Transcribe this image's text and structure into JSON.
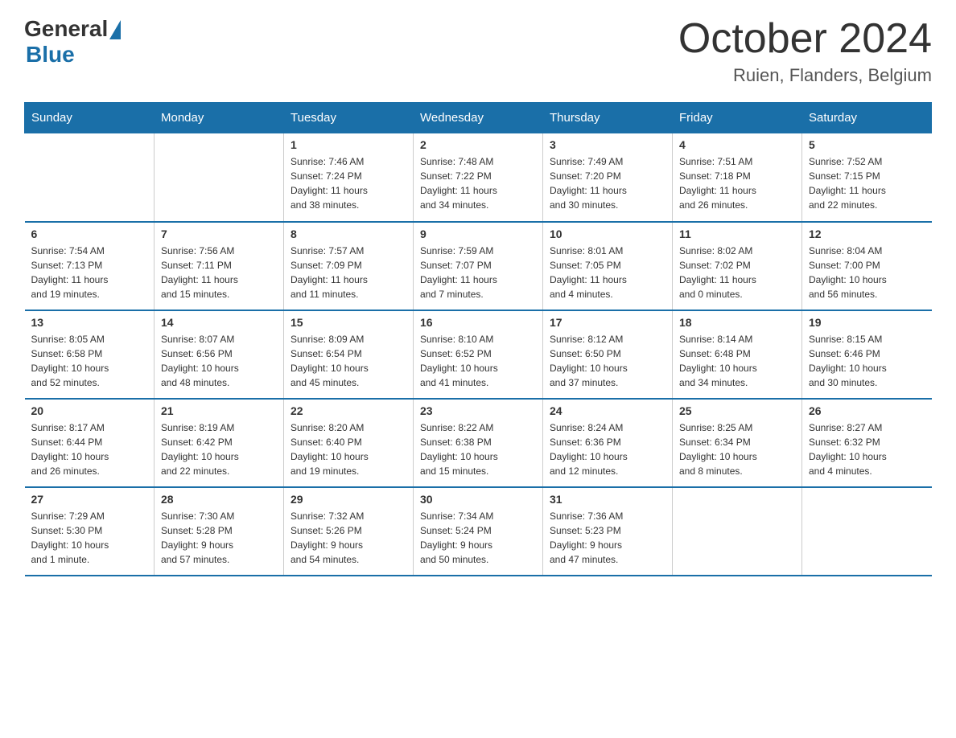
{
  "header": {
    "logo_general": "General",
    "logo_blue": "Blue",
    "month_title": "October 2024",
    "location": "Ruien, Flanders, Belgium"
  },
  "days_header": [
    "Sunday",
    "Monday",
    "Tuesday",
    "Wednesday",
    "Thursday",
    "Friday",
    "Saturday"
  ],
  "weeks": [
    [
      {
        "num": "",
        "info": ""
      },
      {
        "num": "",
        "info": ""
      },
      {
        "num": "1",
        "info": "Sunrise: 7:46 AM\nSunset: 7:24 PM\nDaylight: 11 hours\nand 38 minutes."
      },
      {
        "num": "2",
        "info": "Sunrise: 7:48 AM\nSunset: 7:22 PM\nDaylight: 11 hours\nand 34 minutes."
      },
      {
        "num": "3",
        "info": "Sunrise: 7:49 AM\nSunset: 7:20 PM\nDaylight: 11 hours\nand 30 minutes."
      },
      {
        "num": "4",
        "info": "Sunrise: 7:51 AM\nSunset: 7:18 PM\nDaylight: 11 hours\nand 26 minutes."
      },
      {
        "num": "5",
        "info": "Sunrise: 7:52 AM\nSunset: 7:15 PM\nDaylight: 11 hours\nand 22 minutes."
      }
    ],
    [
      {
        "num": "6",
        "info": "Sunrise: 7:54 AM\nSunset: 7:13 PM\nDaylight: 11 hours\nand 19 minutes."
      },
      {
        "num": "7",
        "info": "Sunrise: 7:56 AM\nSunset: 7:11 PM\nDaylight: 11 hours\nand 15 minutes."
      },
      {
        "num": "8",
        "info": "Sunrise: 7:57 AM\nSunset: 7:09 PM\nDaylight: 11 hours\nand 11 minutes."
      },
      {
        "num": "9",
        "info": "Sunrise: 7:59 AM\nSunset: 7:07 PM\nDaylight: 11 hours\nand 7 minutes."
      },
      {
        "num": "10",
        "info": "Sunrise: 8:01 AM\nSunset: 7:05 PM\nDaylight: 11 hours\nand 4 minutes."
      },
      {
        "num": "11",
        "info": "Sunrise: 8:02 AM\nSunset: 7:02 PM\nDaylight: 11 hours\nand 0 minutes."
      },
      {
        "num": "12",
        "info": "Sunrise: 8:04 AM\nSunset: 7:00 PM\nDaylight: 10 hours\nand 56 minutes."
      }
    ],
    [
      {
        "num": "13",
        "info": "Sunrise: 8:05 AM\nSunset: 6:58 PM\nDaylight: 10 hours\nand 52 minutes."
      },
      {
        "num": "14",
        "info": "Sunrise: 8:07 AM\nSunset: 6:56 PM\nDaylight: 10 hours\nand 48 minutes."
      },
      {
        "num": "15",
        "info": "Sunrise: 8:09 AM\nSunset: 6:54 PM\nDaylight: 10 hours\nand 45 minutes."
      },
      {
        "num": "16",
        "info": "Sunrise: 8:10 AM\nSunset: 6:52 PM\nDaylight: 10 hours\nand 41 minutes."
      },
      {
        "num": "17",
        "info": "Sunrise: 8:12 AM\nSunset: 6:50 PM\nDaylight: 10 hours\nand 37 minutes."
      },
      {
        "num": "18",
        "info": "Sunrise: 8:14 AM\nSunset: 6:48 PM\nDaylight: 10 hours\nand 34 minutes."
      },
      {
        "num": "19",
        "info": "Sunrise: 8:15 AM\nSunset: 6:46 PM\nDaylight: 10 hours\nand 30 minutes."
      }
    ],
    [
      {
        "num": "20",
        "info": "Sunrise: 8:17 AM\nSunset: 6:44 PM\nDaylight: 10 hours\nand 26 minutes."
      },
      {
        "num": "21",
        "info": "Sunrise: 8:19 AM\nSunset: 6:42 PM\nDaylight: 10 hours\nand 22 minutes."
      },
      {
        "num": "22",
        "info": "Sunrise: 8:20 AM\nSunset: 6:40 PM\nDaylight: 10 hours\nand 19 minutes."
      },
      {
        "num": "23",
        "info": "Sunrise: 8:22 AM\nSunset: 6:38 PM\nDaylight: 10 hours\nand 15 minutes."
      },
      {
        "num": "24",
        "info": "Sunrise: 8:24 AM\nSunset: 6:36 PM\nDaylight: 10 hours\nand 12 minutes."
      },
      {
        "num": "25",
        "info": "Sunrise: 8:25 AM\nSunset: 6:34 PM\nDaylight: 10 hours\nand 8 minutes."
      },
      {
        "num": "26",
        "info": "Sunrise: 8:27 AM\nSunset: 6:32 PM\nDaylight: 10 hours\nand 4 minutes."
      }
    ],
    [
      {
        "num": "27",
        "info": "Sunrise: 7:29 AM\nSunset: 5:30 PM\nDaylight: 10 hours\nand 1 minute."
      },
      {
        "num": "28",
        "info": "Sunrise: 7:30 AM\nSunset: 5:28 PM\nDaylight: 9 hours\nand 57 minutes."
      },
      {
        "num": "29",
        "info": "Sunrise: 7:32 AM\nSunset: 5:26 PM\nDaylight: 9 hours\nand 54 minutes."
      },
      {
        "num": "30",
        "info": "Sunrise: 7:34 AM\nSunset: 5:24 PM\nDaylight: 9 hours\nand 50 minutes."
      },
      {
        "num": "31",
        "info": "Sunrise: 7:36 AM\nSunset: 5:23 PM\nDaylight: 9 hours\nand 47 minutes."
      },
      {
        "num": "",
        "info": ""
      },
      {
        "num": "",
        "info": ""
      }
    ]
  ]
}
